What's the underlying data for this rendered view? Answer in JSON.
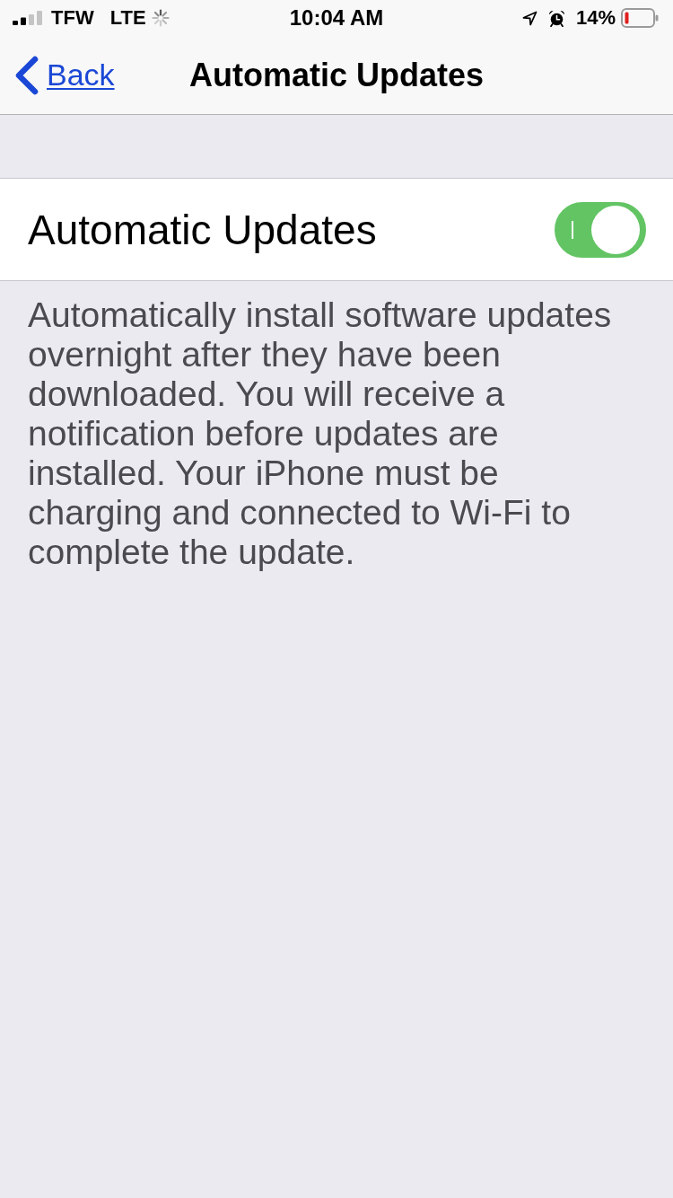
{
  "status_bar": {
    "carrier": "TFW",
    "network": "LTE",
    "time": "10:04 AM",
    "battery_percent": "14%"
  },
  "nav_bar": {
    "back_label": "Back",
    "title": "Automatic Updates"
  },
  "settings": [
    {
      "kind": "toggle",
      "label": "Automatic Updates",
      "on": true
    }
  ],
  "footer": "Automatically install software updates overnight after they have been downloaded. You will receive a notification before updates are installed. Your iPhone must be charging and connected to Wi-Fi to complete the update."
}
